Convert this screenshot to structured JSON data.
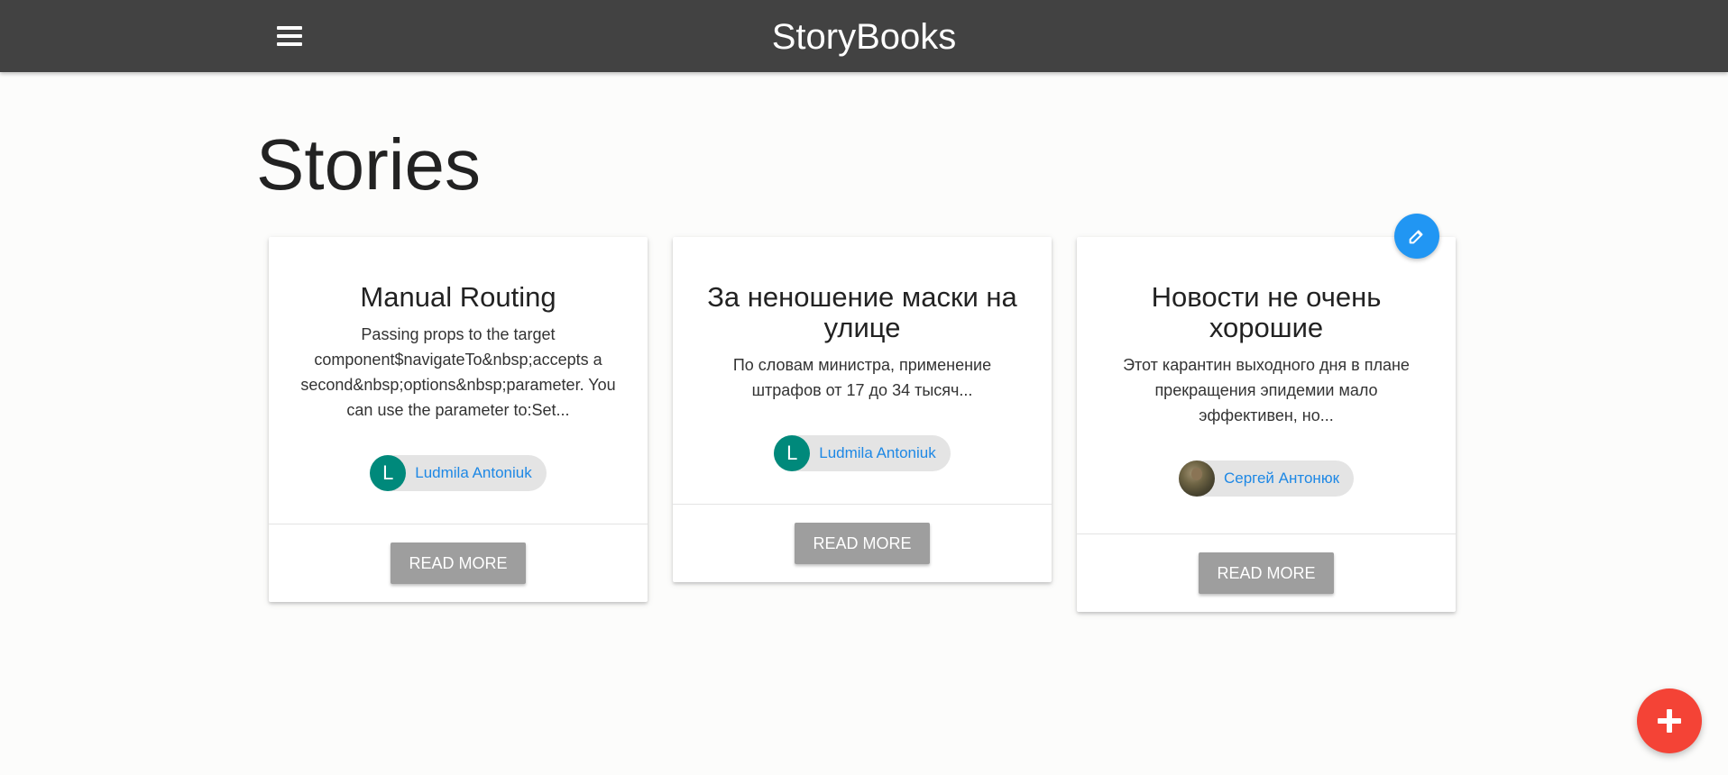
{
  "navbar": {
    "brand": "StoryBooks",
    "menu_icon": "menu-icon",
    "background": "#424242"
  },
  "page": {
    "title": "Stories"
  },
  "stories": [
    {
      "title": "Manual Routing",
      "excerpt": "Passing props to the target component$navigateTo&nbsp;accepts a second&nbsp;options&nbsp;parameter. You can use the parameter to:Set...",
      "author": {
        "name": "Ludmila Antoniuk",
        "initial": "L",
        "avatar_color": "#00897b"
      },
      "action_label": "READ MORE"
    },
    {
      "title": "За неношение маски на улице",
      "excerpt": "По словам министра, применение штрафов от 17 до 34 тысяч...",
      "author": {
        "name": "Ludmila Antoniuk",
        "initial": "L",
        "avatar_color": "#00897b"
      },
      "action_label": "READ MORE"
    },
    {
      "title": "Новости не очень хорошие",
      "excerpt": "Этот карантин выходного дня в плане прекращения эпидемии мало эффективен, но...",
      "author": {
        "name": "Сергей Антонюк",
        "avatar": "user-photo"
      },
      "action_label": "READ MORE",
      "edit_icon": "edit-icon"
    }
  ],
  "fab": {
    "icon": "plus-icon",
    "color": "#f44336"
  },
  "colors": {
    "accent_blue": "#2196f3",
    "link_blue": "#1e88e5",
    "button_grey": "#9e9e9e"
  }
}
